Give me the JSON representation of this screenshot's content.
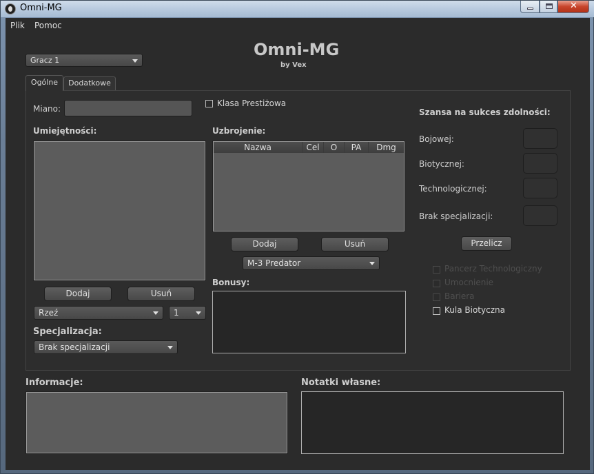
{
  "window": {
    "title": "Omni-MG"
  },
  "menu": {
    "file": "Plik",
    "help": "Pomoc"
  },
  "header": {
    "title": "Omni-MG",
    "subtitle": "by Vex"
  },
  "player_select": {
    "value": "Gracz 1"
  },
  "tabs": [
    {
      "label": "Ogólne"
    },
    {
      "label": "Dodatkowe"
    }
  ],
  "general": {
    "name_label": "Miano:",
    "name_value": "",
    "prestige_class": "Klasa Prestiżowa",
    "skills_label": "Umiejętności:",
    "add_label": "Dodaj",
    "remove_label": "Usuń",
    "skill_select": "Rzeź",
    "level_select": "1",
    "specialization_label": "Specjalizacja:",
    "specialization_select": "Brak specjalizacji",
    "weapons_label": "Uzbrojenie:",
    "weapons_columns": [
      "Nazwa",
      "Cel",
      "O",
      "PA",
      "Dmg"
    ],
    "weapon_select": "M-3 Predator",
    "bonuses_label": "Bonusy:"
  },
  "success": {
    "title": "Szansa na sukces zdolności:",
    "rows": [
      {
        "label": "Bojowej:",
        "value": ""
      },
      {
        "label": "Biotycznej:",
        "value": ""
      },
      {
        "label": "Technologicznej:",
        "value": ""
      },
      {
        "label": "Brak specjalizacji:",
        "value": ""
      }
    ],
    "recalc": "Przelicz",
    "abilities": [
      {
        "label": "Pancerz Technologiczny",
        "enabled": false
      },
      {
        "label": "Umocnienie",
        "enabled": false
      },
      {
        "label": "Bariera",
        "enabled": false
      },
      {
        "label": "Kula Biotyczna",
        "enabled": true
      }
    ]
  },
  "info_label": "Informacje:",
  "notes_label": "Notatki własne:"
}
